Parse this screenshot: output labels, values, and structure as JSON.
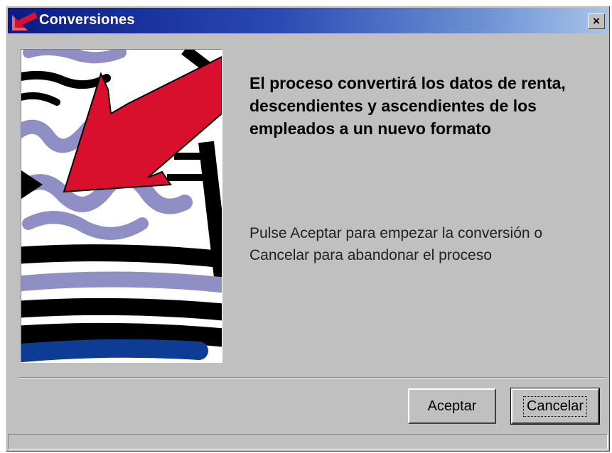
{
  "window": {
    "title": "Conversiones",
    "close_label": "×"
  },
  "content": {
    "headline": "El proceso convertirá los datos de renta, descendientes y ascendientes  de los empleados a un nuevo formato",
    "instructions": "Pulse Aceptar para empezar la conversión o Cancelar para abandonar el proceso"
  },
  "buttons": {
    "accept_label": "Aceptar",
    "cancel_label": "Cancelar"
  },
  "colors": {
    "title_start": "#0a1a86",
    "title_end": "#a8c4ea",
    "arrow_red": "#d8102e",
    "squiggle_lavender": "#8f8fc6",
    "stripe_black": "#000000",
    "stripe_blue": "#0d3c94"
  },
  "icons": {
    "app": "red-arrow-icon",
    "close": "close-icon"
  }
}
